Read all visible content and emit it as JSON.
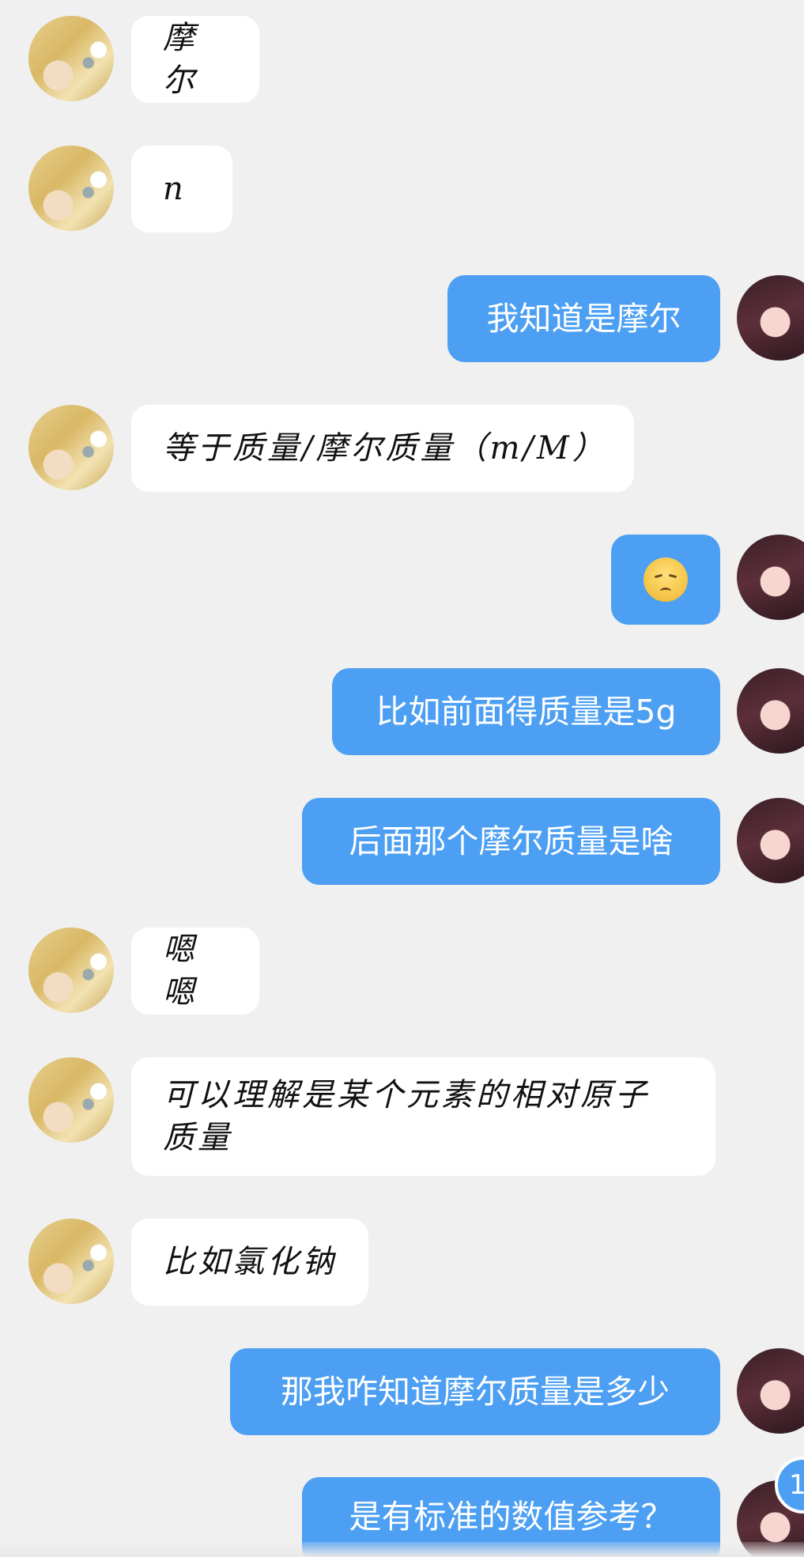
{
  "messages": [
    {
      "side": "recv",
      "text": "摩尔"
    },
    {
      "side": "recv",
      "text": "n"
    },
    {
      "side": "sent",
      "text": "我知道是摩尔"
    },
    {
      "side": "recv",
      "text": "等于质量/摩尔质量（m/M）"
    },
    {
      "side": "sent",
      "emoji": "pensive-face-emoji"
    },
    {
      "side": "sent",
      "text": "比如前面得质量是5g"
    },
    {
      "side": "sent",
      "text": "后面那个摩尔质量是啥"
    },
    {
      "side": "recv",
      "text": "嗯嗯"
    },
    {
      "side": "recv",
      "text": "可以理解是某个元素的相对原子质量"
    },
    {
      "side": "recv",
      "text": "比如氯化钠"
    },
    {
      "side": "sent",
      "text": "那我咋知道摩尔质量是多少"
    },
    {
      "side": "sent",
      "text": "是有标准的数值参考？"
    }
  ],
  "unread_badge": "1",
  "colors": {
    "background": "#f0f0f0",
    "sent_bubble": "#4c9ff2",
    "received_bubble": "#ffffff"
  }
}
